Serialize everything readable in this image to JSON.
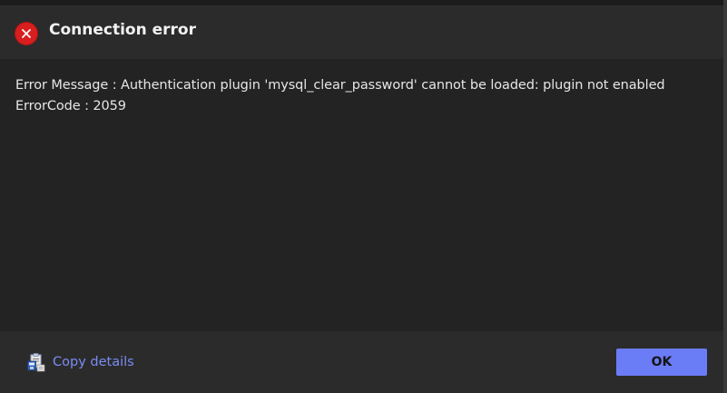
{
  "dialog": {
    "title": "Connection error",
    "icon": "error-icon",
    "error_color": "#d81e1e"
  },
  "message": {
    "line1": "Error Message : Authentication plugin 'mysql_clear_password' cannot be loaded: plugin not enabled",
    "line2": "ErrorCode : 2059"
  },
  "footer": {
    "copy_label": "Copy details",
    "copy_icon": "clipboard-icon",
    "ok_label": "OK",
    "accent_color": "#6b7cf7",
    "link_color": "#7b8cf4"
  }
}
